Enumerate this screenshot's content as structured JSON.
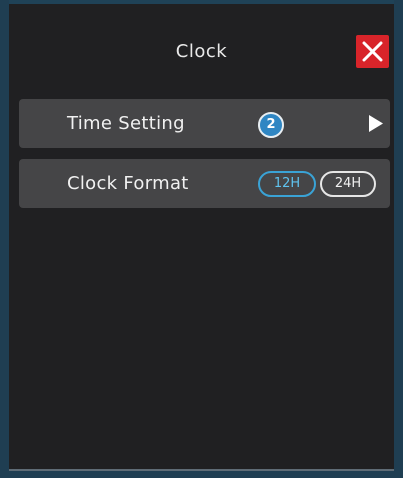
{
  "header": {
    "title": "Clock"
  },
  "icons": {
    "close": "close-icon",
    "arrow": "play-arrow-icon"
  },
  "time_setting": {
    "label": "Time Setting",
    "badge": "2"
  },
  "clock_format": {
    "label": "Clock Format",
    "options": [
      "12H",
      "24H"
    ],
    "selected": "12H"
  },
  "colors": {
    "accent": "#3aa3d6",
    "close": "#d8242a",
    "badge": "#2f86c3",
    "row_bg": "#454547"
  }
}
